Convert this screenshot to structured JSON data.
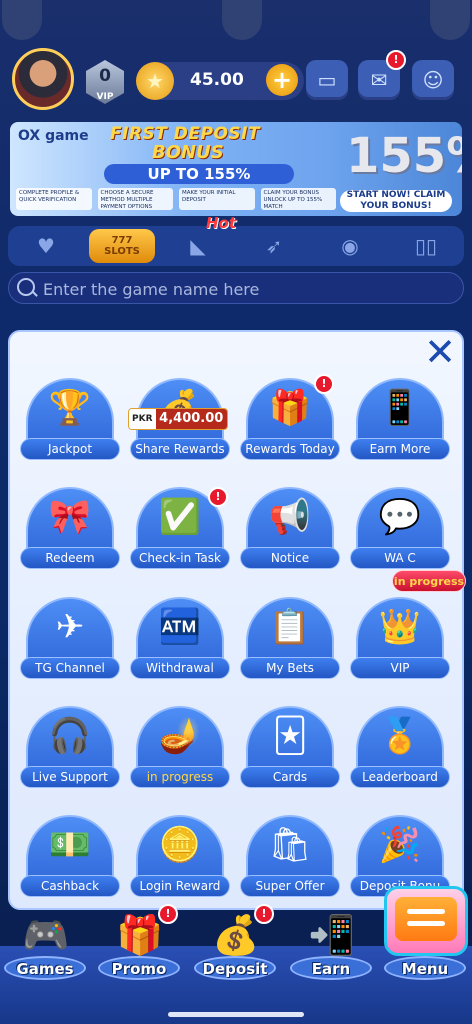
{
  "header": {
    "vip_level": "0",
    "vip_label": "VIP",
    "balance": "45.00",
    "add_label": "+",
    "mail_badge": "!",
    "icons": {
      "wallet": "wallet-icon",
      "mail": "mail-icon",
      "support": "support-chat-icon"
    }
  },
  "banner": {
    "logo": "OX game",
    "title_line1": "FIRST DEPOSIT",
    "title_line2": "BONUS",
    "up_to": "UP TO 155%",
    "big_percent": "155%",
    "cta": "START NOW! CLAIM YOUR BONUS!",
    "steps": [
      "COMPLETE PROFILE & QUICK VERIFICATION",
      "CHOOSE A SECURE METHOD MULTIPLE PAYMENT OPTIONS",
      "MAKE YOUR INITIAL DEPOSIT",
      "CLAIM YOUR BONUS UNLOCK UP TO 155% MATCH"
    ]
  },
  "categories": {
    "items": [
      "favorites-heart-icon",
      "slots-icon",
      "fishing-icon",
      "rocket-icon",
      "joystick-icon",
      "cards-icon"
    ],
    "slots_label": "SLOTS",
    "slots_sub": "777",
    "hot_label": "Hot"
  },
  "search": {
    "placeholder": "Enter the game name here"
  },
  "menu_modal": {
    "close": "✕",
    "items": [
      {
        "label": "Jackpot",
        "icon": "trophy-icon",
        "glyph": "🏆"
      },
      {
        "label": "Share Rewards",
        "icon": "treasure-chest-icon",
        "glyph": "💰",
        "amount_currency": "PKR",
        "amount": "4,400.00"
      },
      {
        "label": "Rewards Today",
        "icon": "gift-megaphone-icon",
        "glyph": "🎁",
        "badge": "!"
      },
      {
        "label": "Earn More",
        "icon": "phone-money-icon",
        "glyph": "📱"
      },
      {
        "label": "Redeem",
        "icon": "code-gift-icon",
        "glyph": "🎀"
      },
      {
        "label": "Check-in Task",
        "icon": "checkin-calendar-icon",
        "glyph": "✅",
        "badge": "!"
      },
      {
        "label": "Notice",
        "icon": "megaphone-icon",
        "glyph": "📢"
      },
      {
        "label": "WA C",
        "icon": "whatsapp-icon",
        "glyph": "💬"
      },
      {
        "label": "TG Channel",
        "icon": "telegram-icon",
        "glyph": "✈"
      },
      {
        "label": "Withdrawal",
        "icon": "atm-icon",
        "glyph": "🏧"
      },
      {
        "label": "My Bets",
        "icon": "bet-slip-icon",
        "glyph": "📋"
      },
      {
        "label": "VIP",
        "icon": "crown-icon",
        "glyph": "👑"
      },
      {
        "label": "Live Support",
        "icon": "support-agent-icon",
        "glyph": "🎧"
      },
      {
        "label": "in progress",
        "icon": "magic-lamp-icon",
        "glyph": "🪔"
      },
      {
        "label": "Cards",
        "icon": "card-icon",
        "glyph": "🃏"
      },
      {
        "label": "Leaderboard",
        "icon": "podium-icon",
        "glyph": "🏅"
      },
      {
        "label": "Cashback",
        "icon": "cashback-register-icon",
        "glyph": "💵"
      },
      {
        "label": "Login Reward",
        "icon": "login-reward-icon",
        "glyph": "🪙"
      },
      {
        "label": "Super Offer",
        "icon": "shopping-bag-icon",
        "glyph": "🛍"
      },
      {
        "label": "Deposit Bonu",
        "icon": "percent-gift-icon",
        "glyph": "🎉"
      }
    ],
    "floating_status": "in progress"
  },
  "bottom_nav": [
    {
      "label": "Games",
      "icon": "games-icon",
      "glyph": "🎮"
    },
    {
      "label": "Promo",
      "icon": "promo-gift-icon",
      "glyph": "🎁",
      "badge": "!"
    },
    {
      "label": "Deposit",
      "icon": "deposit-chest-icon",
      "glyph": "💰",
      "badge": "!"
    },
    {
      "label": "Earn",
      "icon": "earn-phone-icon",
      "glyph": "📲"
    },
    {
      "label": "Menu",
      "icon": "menu-tv-icon",
      "glyph": ""
    }
  ]
}
